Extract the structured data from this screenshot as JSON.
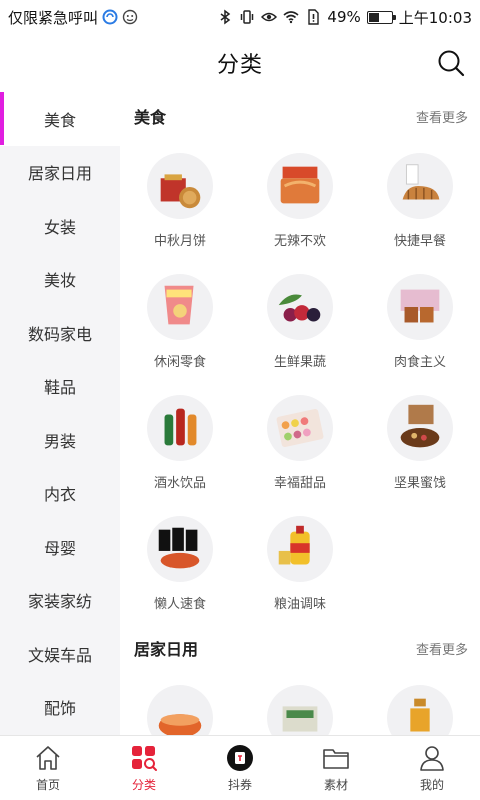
{
  "status_bar": {
    "left_text": "仅限紧急呼叫",
    "battery": "49%",
    "battery_level": 0.49,
    "time": "上午10:03"
  },
  "header": {
    "title": "分类"
  },
  "sidebar": {
    "items": [
      {
        "label": "美食"
      },
      {
        "label": "居家日用"
      },
      {
        "label": "女装"
      },
      {
        "label": "美妆"
      },
      {
        "label": "数码家电"
      },
      {
        "label": "鞋品"
      },
      {
        "label": "男装"
      },
      {
        "label": "内衣"
      },
      {
        "label": "母婴"
      },
      {
        "label": "家装家纺"
      },
      {
        "label": "文娱车品"
      },
      {
        "label": "配饰"
      }
    ]
  },
  "sections": [
    {
      "title": "美食",
      "more": "查看更多",
      "items": [
        {
          "label": "中秋月饼",
          "icon": "mooncake-icon"
        },
        {
          "label": "无辣不欢",
          "icon": "spicy-snack-icon"
        },
        {
          "label": "快捷早餐",
          "icon": "bread-icon"
        },
        {
          "label": "休闲零食",
          "icon": "chips-icon"
        },
        {
          "label": "生鲜果蔬",
          "icon": "berries-icon"
        },
        {
          "label": "肉食主义",
          "icon": "meat-icon"
        },
        {
          "label": "酒水饮品",
          "icon": "drinks-icon"
        },
        {
          "label": "幸福甜品",
          "icon": "macaron-icon"
        },
        {
          "label": "坚果蜜饯",
          "icon": "nuts-icon"
        },
        {
          "label": "懒人速食",
          "icon": "instant-noodle-icon"
        },
        {
          "label": "粮油调味",
          "icon": "oil-bottle-icon"
        }
      ]
    },
    {
      "title": "居家日用",
      "more": "查看更多",
      "items": [
        {
          "label": "",
          "icon": "pot-icon"
        },
        {
          "label": "",
          "icon": "storage-icon"
        },
        {
          "label": "",
          "icon": "shampoo-icon"
        }
      ]
    }
  ],
  "tabbar": {
    "items": [
      {
        "label": "首页"
      },
      {
        "label": "分类"
      },
      {
        "label": "抖券"
      },
      {
        "label": "素材"
      },
      {
        "label": "我的"
      }
    ]
  },
  "colors": {
    "accent": "#e5233a",
    "sidebar_indicator": "#e01ee0",
    "sidebar_bg": "#f5f5f7"
  }
}
